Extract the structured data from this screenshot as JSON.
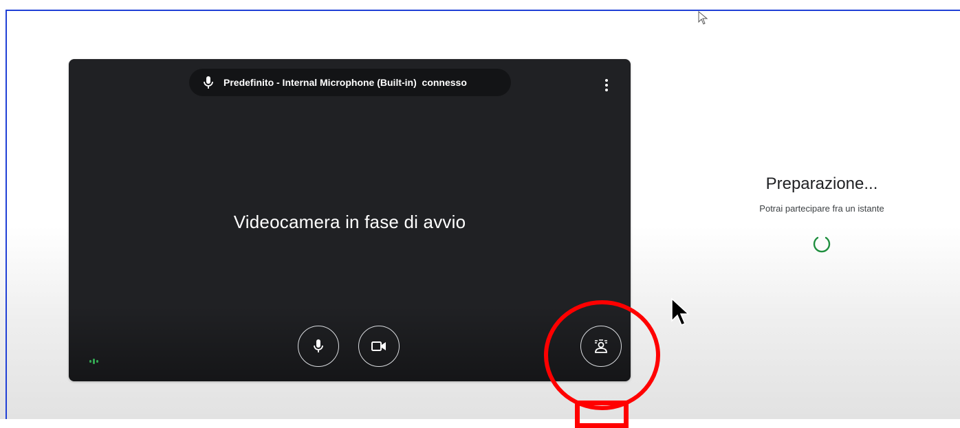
{
  "preview": {
    "mic_status": "Predefinito - Internal Microphone (Built-in)  connesso",
    "camera_status": "Videocamera in fase di avvio",
    "controls": {
      "mic_icon": "microphone-icon",
      "camera_icon": "videocam-icon",
      "effects_icon": "visual-effects-icon",
      "more_icon": "more-vert-icon"
    }
  },
  "side_panel": {
    "title": "Preparazione...",
    "subtitle": "Potrai partecipare fra un istante",
    "spinner_icon": "loading-spinner-icon"
  },
  "colors": {
    "annotation": "#ff0000",
    "accent_green": "#1e8e3e",
    "preview_bg": "#202124",
    "frame": "#1f3fd6"
  }
}
